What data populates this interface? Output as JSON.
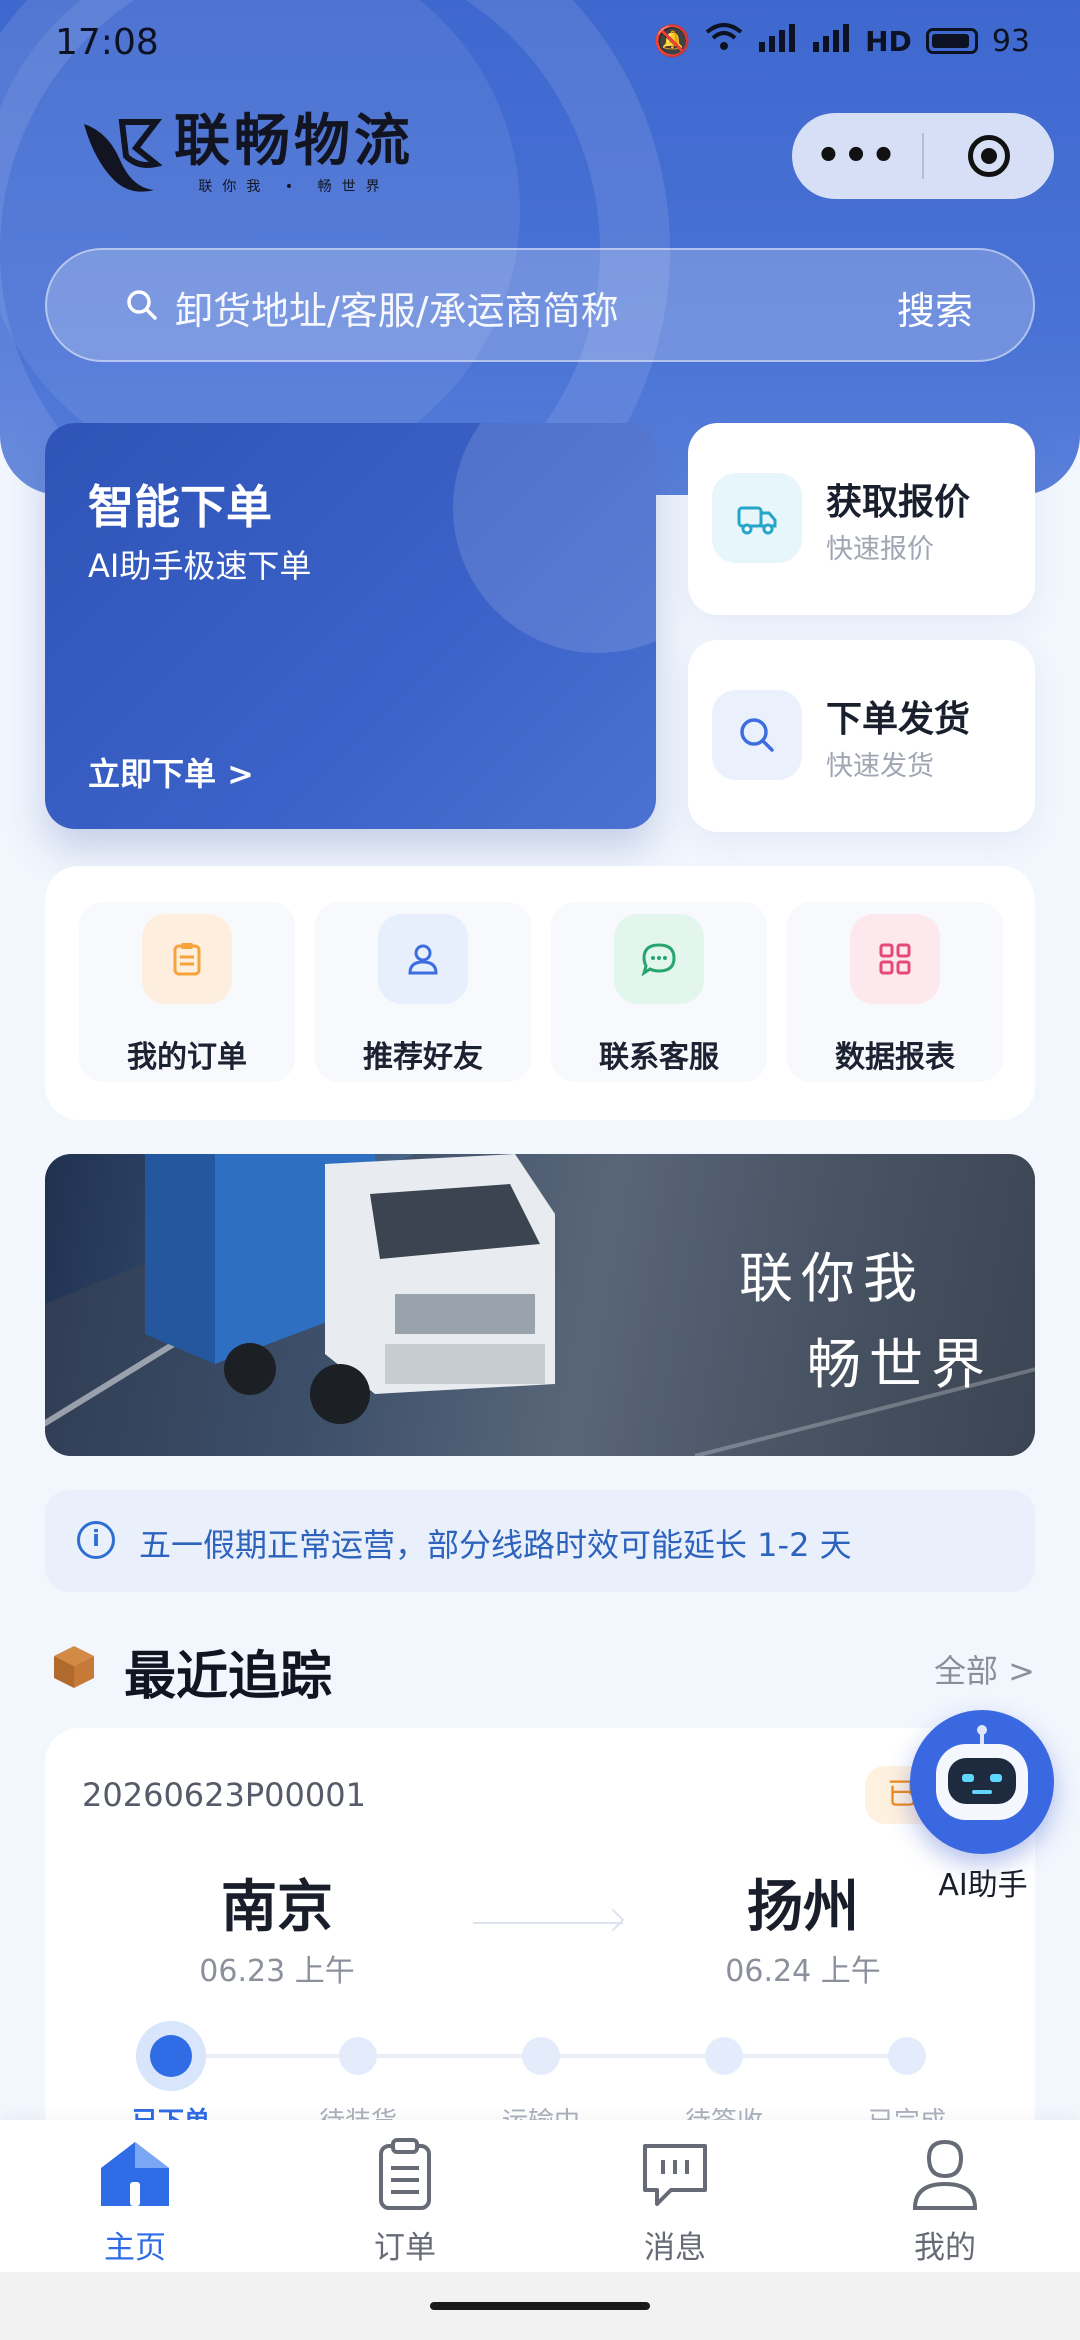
{
  "status_bar": {
    "time": "17:08",
    "network": "4G 5G HD",
    "battery": "93"
  },
  "header": {
    "logo_title": "联畅物流",
    "logo_sub": "联你我 • 畅世界",
    "capsule_more": "•••"
  },
  "search": {
    "placeholder": "卸货地址/客服/承运商简称",
    "button": "搜索"
  },
  "smart_order": {
    "title": "智能下单",
    "subtitle": "AI助手极速下单",
    "cta": "立即下单 >"
  },
  "side_cards": [
    {
      "title": "获取报价",
      "subtitle": "快速报价",
      "icon": "truck-icon"
    },
    {
      "title": "下单发货",
      "subtitle": "快速发货",
      "icon": "search-icon"
    }
  ],
  "quick_menu": [
    {
      "label": "我的订单",
      "icon": "clipboard-icon",
      "color": "#f5a33a"
    },
    {
      "label": "推荐好友",
      "icon": "user-icon",
      "color": "#3c6ee0"
    },
    {
      "label": "联系客服",
      "icon": "chat-icon",
      "color": "#27a46f"
    },
    {
      "label": "数据报表",
      "icon": "grid-icon",
      "color": "#e5487a"
    }
  ],
  "banner": {
    "line1": "联你我",
    "line2": "畅世界"
  },
  "notice": {
    "text": "五一假期正常运营，部分线路时效可能延长 1-2 天"
  },
  "recent": {
    "title": "最近追踪",
    "all_link": "全部 >",
    "order_no": "20260623P00001",
    "status_badge": "已",
    "origin": {
      "city": "南京",
      "time": "06.23 上午"
    },
    "destination": {
      "city": "扬州",
      "time": "06.24 上午"
    },
    "steps": [
      "已下单",
      "待装货",
      "运输中",
      "待签收",
      "已完成"
    ],
    "current_step": 0
  },
  "ai_assistant": {
    "label": "AI助手"
  },
  "tabs": [
    {
      "label": "主页",
      "icon": "home-icon",
      "active": true
    },
    {
      "label": "订单",
      "icon": "clipboard-icon",
      "active": false
    },
    {
      "label": "消息",
      "icon": "message-icon",
      "active": false
    },
    {
      "label": "我的",
      "icon": "user-icon",
      "active": false
    }
  ],
  "colors": {
    "primary": "#3f68cf",
    "accent": "#2f6ce5",
    "notice_text": "#2d63bd",
    "badge": "#ef8a1d"
  }
}
